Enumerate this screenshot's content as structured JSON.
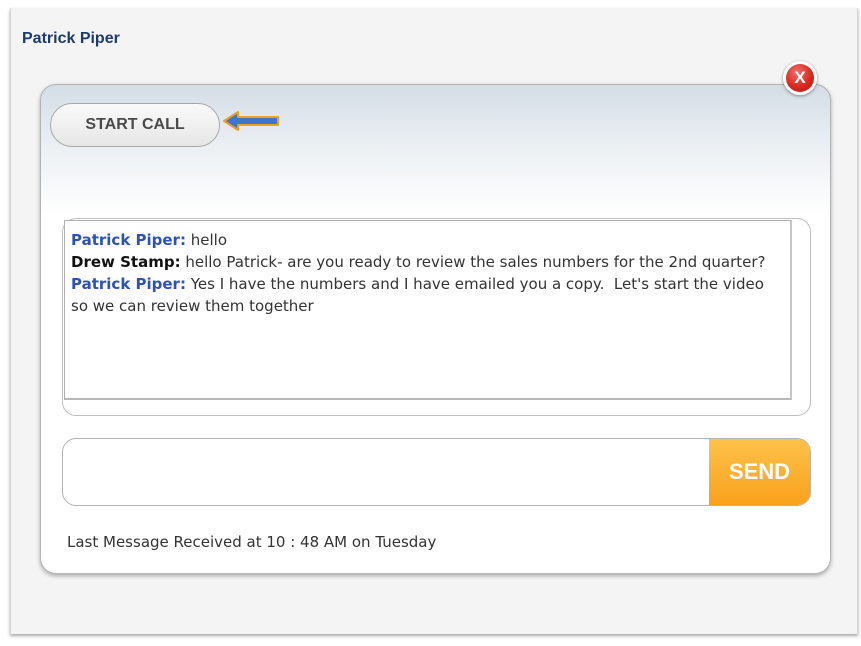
{
  "window": {
    "title": "Patrick Piper"
  },
  "toolbar": {
    "start_call_label": "START CALL",
    "close_label": "X"
  },
  "transcript": {
    "messages": [
      {
        "speaker": "Patrick Piper:",
        "text": "hello"
      },
      {
        "speaker": "Drew Stamp:",
        "text": "hello Patrick- are you ready to review the sales numbers for the 2nd quarter?"
      },
      {
        "speaker": "Patrick Piper:",
        "text": "Yes I have the numbers and I have emailed you a copy.  Let's start the video so we can review them together"
      }
    ]
  },
  "composer": {
    "value": "",
    "placeholder": "",
    "send_label": "SEND"
  },
  "status": {
    "text": "Last Message Received at 10 : 48 AM on Tuesday"
  },
  "icons": {
    "close": "close-icon",
    "pointer": "arrow-left-icon"
  },
  "colors": {
    "speaker_self": "#2c52b8",
    "speaker_other": "#111111",
    "send_button": "#f9a11b",
    "close_button": "#d8291f",
    "arrow_fill": "#3c78c8",
    "arrow_outline": "#f0a020"
  }
}
